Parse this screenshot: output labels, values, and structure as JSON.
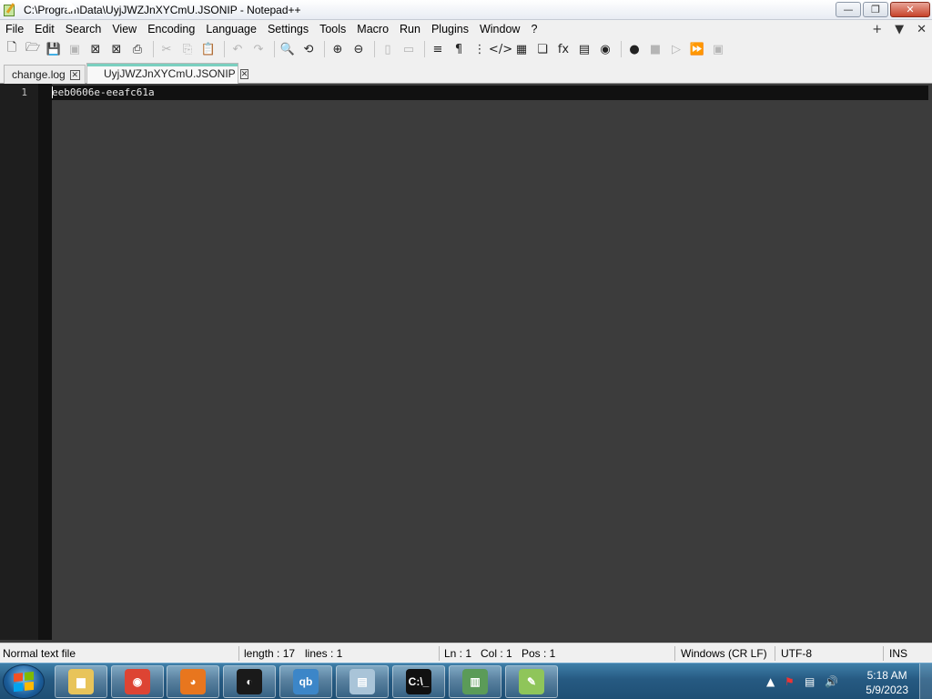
{
  "window": {
    "title": "C:\\ProgramData\\UyjJWZJnXYCmU.JSONIP - Notepad++",
    "minimize_glyph": "—",
    "maximize_glyph": "❐",
    "close_glyph": "✕"
  },
  "menu": {
    "items": [
      "File",
      "Edit",
      "Search",
      "View",
      "Encoding",
      "Language",
      "Settings",
      "Tools",
      "Macro",
      "Run",
      "Plugins",
      "Window",
      "?"
    ],
    "right_controls": [
      "+",
      "▼",
      "✕"
    ]
  },
  "toolbar": {
    "buttons": [
      {
        "icon": "new-file-icon",
        "glyph": "🗋",
        "enabled": true
      },
      {
        "icon": "open-folder-icon",
        "glyph": "🗁",
        "enabled": true
      },
      {
        "icon": "save-icon",
        "glyph": "💾",
        "enabled": false
      },
      {
        "icon": "save-all-icon",
        "glyph": "▣",
        "enabled": false
      },
      {
        "icon": "close-file-icon",
        "glyph": "⊠",
        "enabled": true
      },
      {
        "icon": "close-all-icon",
        "glyph": "⊠",
        "enabled": true
      },
      {
        "icon": "print-icon",
        "glyph": "⎙",
        "enabled": true
      },
      {
        "sep": true
      },
      {
        "icon": "cut-icon",
        "glyph": "✂",
        "enabled": false
      },
      {
        "icon": "copy-icon",
        "glyph": "⎘",
        "enabled": false
      },
      {
        "icon": "paste-icon",
        "glyph": "📋",
        "enabled": false
      },
      {
        "sep": true
      },
      {
        "icon": "undo-icon",
        "glyph": "↶",
        "enabled": false
      },
      {
        "icon": "redo-icon",
        "glyph": "↷",
        "enabled": false
      },
      {
        "sep": true
      },
      {
        "icon": "find-icon",
        "glyph": "🔍",
        "enabled": true
      },
      {
        "icon": "replace-icon",
        "glyph": "⟲",
        "enabled": true
      },
      {
        "sep": true
      },
      {
        "icon": "zoom-in-icon",
        "glyph": "⊕",
        "enabled": true
      },
      {
        "icon": "zoom-out-icon",
        "glyph": "⊖",
        "enabled": true
      },
      {
        "sep": true
      },
      {
        "icon": "sync-vertical-icon",
        "glyph": "▯",
        "enabled": false
      },
      {
        "icon": "sync-horizontal-icon",
        "glyph": "▭",
        "enabled": false
      },
      {
        "sep": true
      },
      {
        "icon": "word-wrap-icon",
        "glyph": "≡",
        "enabled": true
      },
      {
        "icon": "show-all-chars-icon",
        "glyph": "¶",
        "enabled": true
      },
      {
        "icon": "indent-guide-icon",
        "glyph": "⋮",
        "enabled": true
      },
      {
        "icon": "xml-tags-icon",
        "glyph": "</>",
        "enabled": true
      },
      {
        "icon": "document-map-icon",
        "glyph": "▦",
        "enabled": true
      },
      {
        "icon": "document-list-icon",
        "glyph": "❏",
        "enabled": true
      },
      {
        "icon": "function-list-icon",
        "glyph": "fx",
        "enabled": true
      },
      {
        "icon": "folder-as-workspace-icon",
        "glyph": "▤",
        "enabled": true
      },
      {
        "icon": "monitoring-icon",
        "glyph": "◉",
        "enabled": true
      },
      {
        "sep": true
      },
      {
        "icon": "record-macro-icon",
        "glyph": "●",
        "enabled": true
      },
      {
        "icon": "stop-recording-icon",
        "glyph": "■",
        "enabled": false
      },
      {
        "icon": "playback-macro-icon",
        "glyph": "▷",
        "enabled": false
      },
      {
        "icon": "run-macro-multiple-icon",
        "glyph": "⏩",
        "enabled": true
      },
      {
        "icon": "save-macro-icon",
        "glyph": "▣",
        "enabled": false
      }
    ]
  },
  "tabs": [
    {
      "label": "change.log",
      "active": false,
      "close_glyph": "✕"
    },
    {
      "label": "UyjJWZJnXYCmU.JSONIP",
      "active": true,
      "close_glyph": "✕"
    }
  ],
  "editor": {
    "line_number": "1",
    "content": "eeb0606e-eeafc61a"
  },
  "status": {
    "file_type": "Normal text file",
    "length": "length : 17",
    "lines": "lines : 1",
    "ln": "Ln : 1",
    "col": "Col : 1",
    "pos": "Pos : 1",
    "eol": "Windows (CR LF)",
    "encoding": "UTF-8",
    "mode": "INS"
  },
  "taskbar": {
    "apps": [
      {
        "name": "explorer",
        "icon": "folder-icon",
        "color": "#e8c45a",
        "glyph": "▆"
      },
      {
        "name": "chrome",
        "icon": "chrome-icon",
        "color": "#dd4433",
        "glyph": "◉"
      },
      {
        "name": "firefox",
        "icon": "firefox-icon",
        "color": "#e8761e",
        "glyph": "◕"
      },
      {
        "name": "media",
        "icon": "media-player-icon",
        "color": "#1a1a1a",
        "glyph": "◐"
      },
      {
        "name": "qbittorrent",
        "icon": "qbittorrent-icon",
        "color": "#3c86c8",
        "glyph": "qb"
      },
      {
        "name": "notes",
        "icon": "notebook-icon",
        "color": "#a9c4d8",
        "glyph": "▤"
      },
      {
        "name": "cmd",
        "icon": "command-prompt-icon",
        "color": "#111111",
        "glyph": "C:\\_"
      },
      {
        "name": "network",
        "icon": "network-tool-icon",
        "color": "#5b9b58",
        "glyph": "▥"
      },
      {
        "name": "notepadpp",
        "icon": "notepadpp-icon",
        "color": "#8fc55a",
        "glyph": "✎"
      }
    ],
    "clock_time": "5:18 AM",
    "clock_date": "5/9/2023"
  },
  "colors": {
    "editor_bg": "#3c3c3c",
    "gutter_bg": "#1e1e1e",
    "active_tab_accent": "#7ad0c0"
  }
}
